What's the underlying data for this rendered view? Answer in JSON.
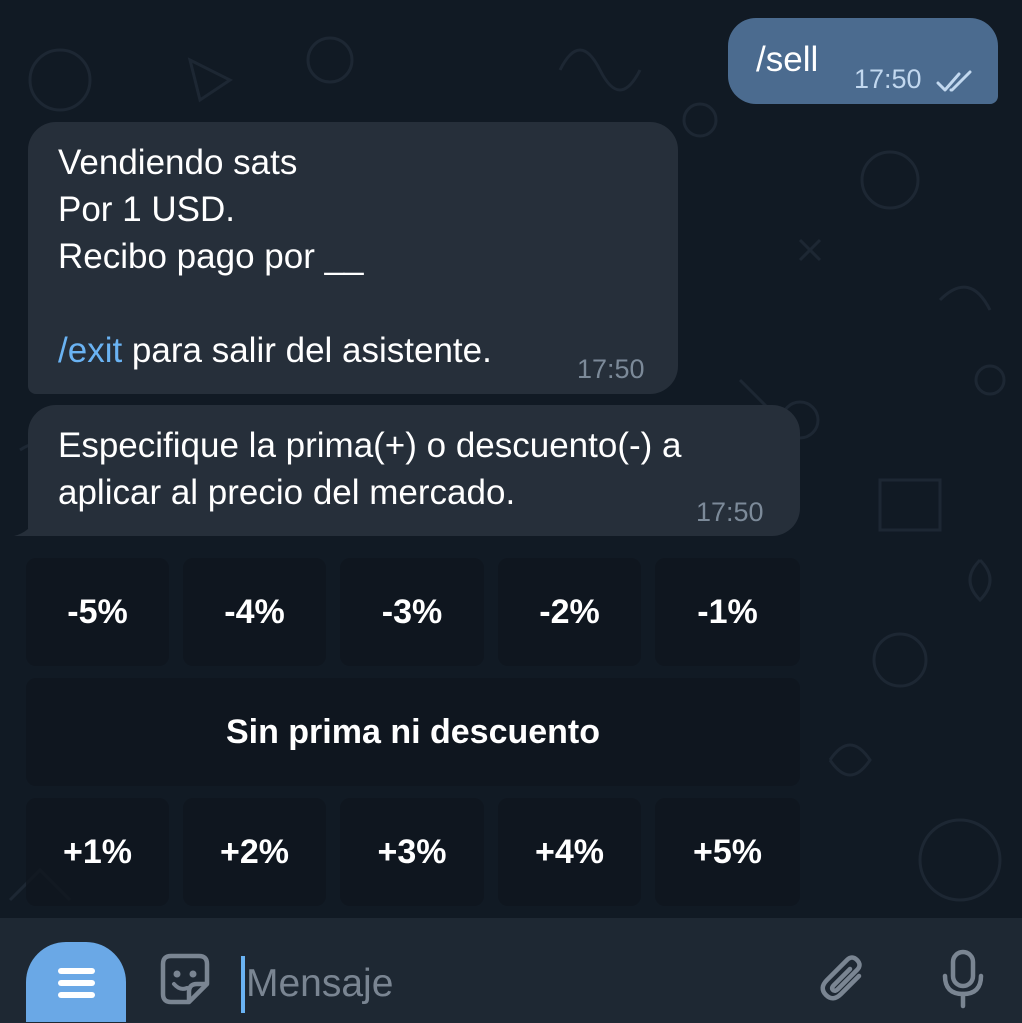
{
  "chat": {
    "outgoing": {
      "text": "/sell",
      "time": "17:50",
      "status_icon": "double-check-icon"
    },
    "incoming": [
      {
        "lines": [
          "Vendiendo sats",
          "Por 1 USD.",
          "Recibo pago por __",
          ""
        ],
        "command": "/exit",
        "command_suffix": " para salir del asistente.",
        "time": "17:50"
      },
      {
        "text": "Especifique la prima(+) o descuento(-) a\naplicar al precio del mercado.",
        "time": "17:50"
      }
    ]
  },
  "keyboard": {
    "row1": [
      "-5%",
      "-4%",
      "-3%",
      "-2%",
      "-1%"
    ],
    "row2": [
      "Sin prima ni descuento"
    ],
    "row3": [
      "+1%",
      "+2%",
      "+3%",
      "+4%",
      "+5%"
    ]
  },
  "input": {
    "placeholder": "Mensaje",
    "icons": [
      "menu-icon",
      "sticker-icon",
      "paperclip-icon",
      "microphone-icon"
    ]
  },
  "colors": {
    "background": "#0e1621",
    "outgoing_bubble": "#4b6b8f",
    "incoming_bubble": "#262f3a",
    "link": "#6ab3f3",
    "accent": "#6aa8e6"
  }
}
